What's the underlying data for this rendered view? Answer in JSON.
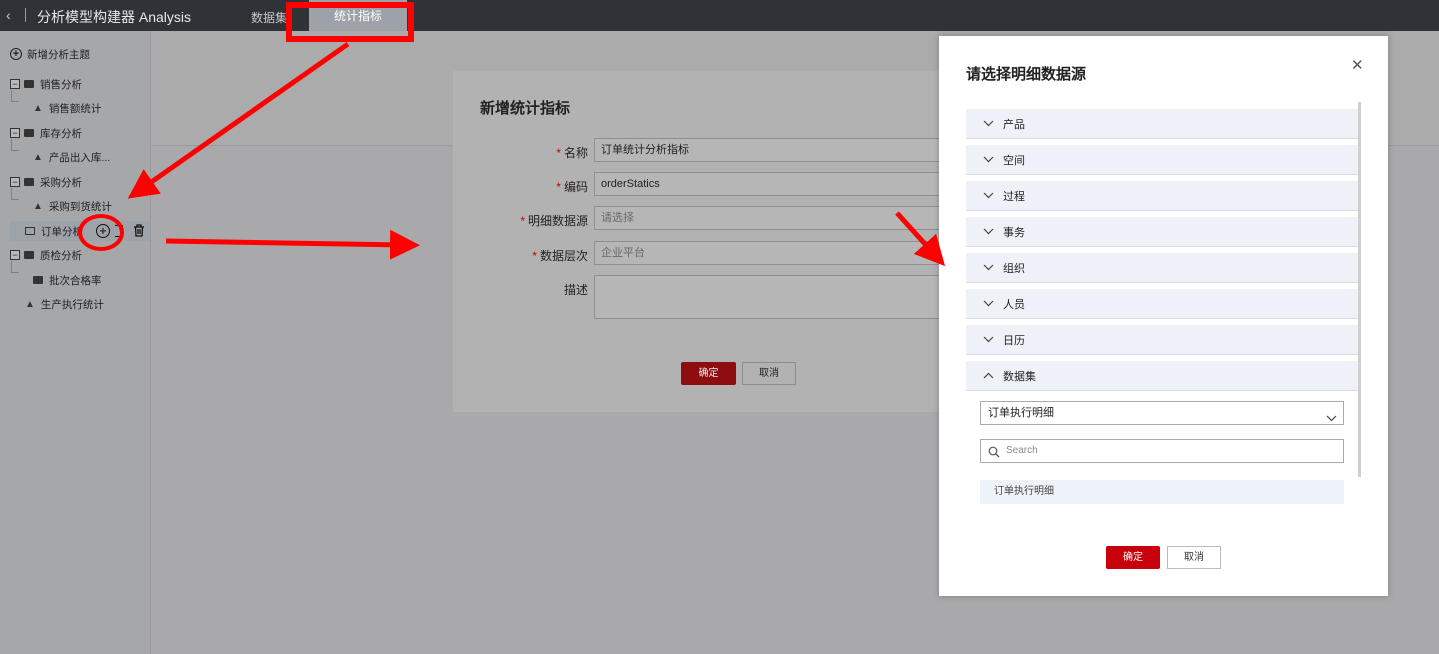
{
  "topbar": {
    "back_icon": "chevron-left-icon",
    "app_title": "分析模型构建器 Analysis",
    "tabs": [
      {
        "label": "数据集",
        "active": false
      },
      {
        "label": "统计指标",
        "active": true
      }
    ]
  },
  "sidebar": {
    "add_theme": "新增分析主题",
    "tree": [
      {
        "label": "销售分析",
        "children": [
          "销售额统计"
        ]
      },
      {
        "label": "库存分析",
        "children": [
          "产品出入库..."
        ]
      },
      {
        "label": "采购分析",
        "children": [
          "采购到货统计"
        ]
      },
      {
        "label": "订单分析",
        "children": []
      },
      {
        "label": "质检分析",
        "children": [
          "批次合格率"
        ]
      },
      {
        "label": "生产执行统计",
        "children": []
      }
    ]
  },
  "add_metric_dialog": {
    "title": "新增统计指标",
    "fields": [
      {
        "label": "名称",
        "required": true,
        "value": "订单统计分析指标",
        "placeholder": ""
      },
      {
        "label": "编码",
        "required": true,
        "value": "orderStatics",
        "placeholder": ""
      },
      {
        "label": "明细数据源",
        "required": true,
        "value": "",
        "placeholder": "请选择"
      },
      {
        "label": "数据层次",
        "required": true,
        "value": "企业平台",
        "placeholder": ""
      },
      {
        "label": "描述",
        "required": false,
        "value": "",
        "placeholder": ""
      }
    ],
    "ok_label": "确定",
    "cancel_label": "取消"
  },
  "datasource_dialog": {
    "title": "请选择明细数据源",
    "close_icon": "close-icon",
    "sections": [
      {
        "label": "产品",
        "expanded": false
      },
      {
        "label": "空间",
        "expanded": false
      },
      {
        "label": "过程",
        "expanded": false
      },
      {
        "label": "事务",
        "expanded": false
      },
      {
        "label": "组织",
        "expanded": false
      },
      {
        "label": "人员",
        "expanded": false
      },
      {
        "label": "日历",
        "expanded": false
      },
      {
        "label": "数据集",
        "expanded": true
      }
    ],
    "dataset_select_value": "订单执行明细",
    "search_placeholder": "Search",
    "list_items": [
      "订单执行明细"
    ],
    "ok_label": "确定",
    "cancel_label": "取消"
  },
  "colors": {
    "annotation_red": "#ff0000",
    "primary_button": "#c7000b",
    "topbar_bg": "#2f3237"
  }
}
